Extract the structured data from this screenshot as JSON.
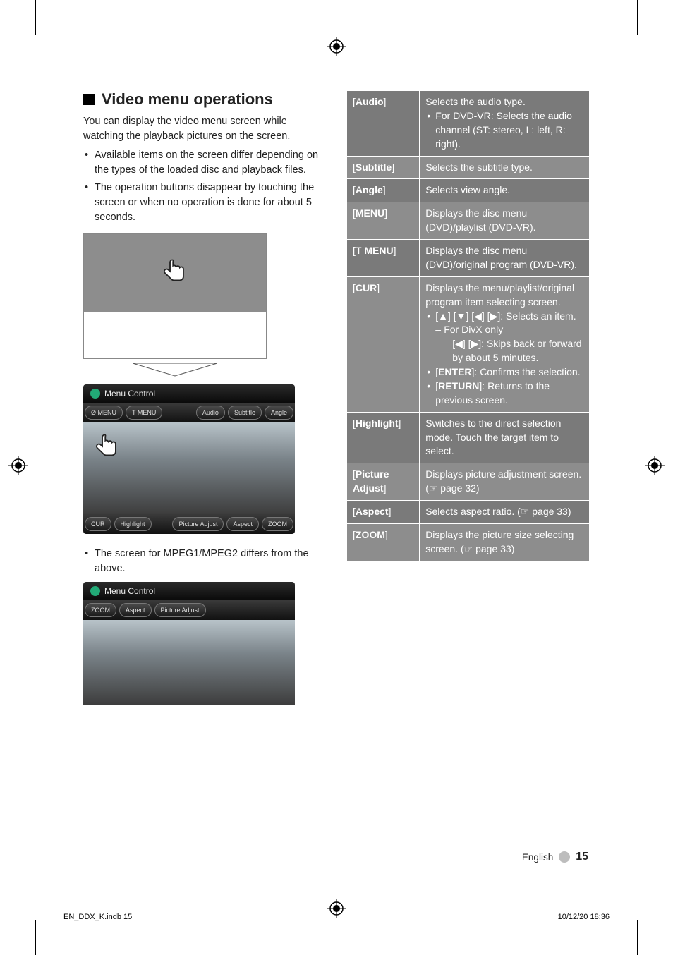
{
  "heading": "Video menu operations",
  "intro": "You can display the video menu screen while watching the playback pictures on the screen.",
  "bullets": [
    "Available items on the screen differ depending on the types of the loaded disc and playback files.",
    "The operation buttons disappear by touching the screen or when no operation is done for about 5 seconds."
  ],
  "menu_control_title": "Menu Control",
  "fig2_top_left": [
    "Ø MENU",
    "T MENU"
  ],
  "fig2_top_right": [
    "Audio",
    "Subtitle",
    "Angle"
  ],
  "fig2_bottom_left": [
    "CUR",
    "Highlight"
  ],
  "fig2_bottom_right": [
    "Picture Adjust",
    "Aspect",
    "ZOOM"
  ],
  "note2": "The screen for MPEG1/MPEG2 differs from the above.",
  "fig3_row_left": [
    "ZOOM",
    "Aspect",
    "Picture Adjust"
  ],
  "table": [
    {
      "label_html": "[<b>Audio</b>]",
      "desc": [
        {
          "t": "plain",
          "v": "Selects the audio type."
        },
        {
          "t": "bullet",
          "v": "For DVD-VR: Selects the audio channel (ST: stereo, L: left, R: right)."
        }
      ]
    },
    {
      "label_html": "[<b>Subtitle</b>]",
      "desc": [
        {
          "t": "plain",
          "v": "Selects the subtitle type."
        }
      ]
    },
    {
      "label_html": "[<b>Angle</b>]",
      "desc": [
        {
          "t": "plain",
          "v": "Selects view angle."
        }
      ]
    },
    {
      "label_html": "[<b>MENU</b>]",
      "desc": [
        {
          "t": "plain",
          "v": "Displays the disc menu (DVD)/playlist (DVD-VR)."
        }
      ]
    },
    {
      "label_html": "[<b>T MENU</b>]",
      "desc": [
        {
          "t": "plain",
          "v": "Displays the disc menu (DVD)/original program (DVD-VR)."
        }
      ]
    },
    {
      "label_html": "[<b>CUR</b>]",
      "desc": [
        {
          "t": "plain",
          "v": "Displays the menu/playlist/original program item selecting screen."
        },
        {
          "t": "bullet",
          "v": "[▲] [▼] [◀] [▶]: Selects an item."
        },
        {
          "t": "dash",
          "v": "For DivX only"
        },
        {
          "t": "indent2",
          "v": "[◀] [▶]: Skips back or forward by about 5 minutes."
        },
        {
          "t": "bullet_html",
          "v": "[<b>ENTER</b>]: Confirms the selection."
        },
        {
          "t": "bullet_html",
          "v": "[<b>RETURN</b>]: Returns to the previous screen."
        }
      ]
    },
    {
      "label_html": "[<b>Highlight</b>]",
      "desc": [
        {
          "t": "plain",
          "v": "Switches to the direct selection mode. Touch the target item to select."
        }
      ]
    },
    {
      "label_html": "[<b>Picture Adjust</b>]",
      "desc": [
        {
          "t": "plain",
          "v": "Displays picture adjustment screen. (☞ page 32)"
        }
      ]
    },
    {
      "label_html": "[<b>Aspect</b>]",
      "desc": [
        {
          "t": "plain",
          "v": "Selects aspect ratio. (☞ page 33)"
        }
      ]
    },
    {
      "label_html": "[<b>ZOOM</b>]",
      "desc": [
        {
          "t": "plain",
          "v": "Displays the picture size selecting screen. (☞ page 33)"
        }
      ]
    }
  ],
  "footer_lang": "English",
  "footer_page": "15",
  "print_left": "EN_DDX_K.indb   15",
  "print_right": "10/12/20   18:36"
}
